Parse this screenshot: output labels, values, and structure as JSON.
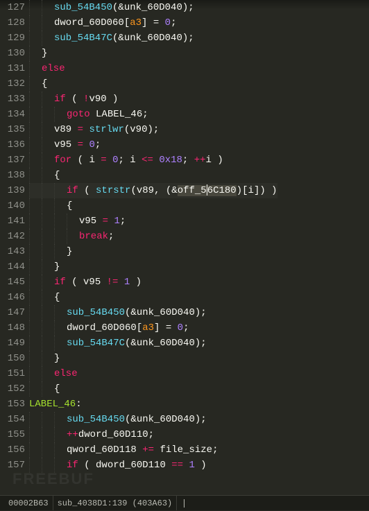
{
  "firstLine": 127,
  "lines": [
    {
      "indent": 2,
      "tokens": [
        {
          "t": "sub_54B450",
          "c": "fn"
        },
        {
          "t": "(&",
          "c": "punct"
        },
        {
          "t": "unk_60D040",
          "c": "id"
        },
        {
          "t": ");",
          "c": "punct"
        }
      ]
    },
    {
      "indent": 2,
      "tokens": [
        {
          "t": "dword_60D060",
          "c": "id"
        },
        {
          "t": "[",
          "c": "punct"
        },
        {
          "t": "a3",
          "c": "param"
        },
        {
          "t": "] = ",
          "c": "punct"
        },
        {
          "t": "0",
          "c": "num"
        },
        {
          "t": ";",
          "c": "punct"
        }
      ]
    },
    {
      "indent": 2,
      "tokens": [
        {
          "t": "sub_54B47C",
          "c": "fn"
        },
        {
          "t": "(&",
          "c": "punct"
        },
        {
          "t": "unk_60D040",
          "c": "id"
        },
        {
          "t": ");",
          "c": "punct"
        }
      ]
    },
    {
      "indent": 1,
      "tokens": [
        {
          "t": "}",
          "c": "punct"
        }
      ]
    },
    {
      "indent": 1,
      "tokens": [
        {
          "t": "else",
          "c": "kw"
        }
      ]
    },
    {
      "indent": 1,
      "tokens": [
        {
          "t": "{",
          "c": "punct"
        }
      ]
    },
    {
      "indent": 2,
      "tokens": [
        {
          "t": "if",
          "c": "kw"
        },
        {
          "t": " ( ",
          "c": "punct"
        },
        {
          "t": "!",
          "c": "op"
        },
        {
          "t": "v90",
          "c": "id"
        },
        {
          "t": " )",
          "c": "punct"
        }
      ]
    },
    {
      "indent": 3,
      "tokens": [
        {
          "t": "goto",
          "c": "kw"
        },
        {
          "t": " ",
          "c": "punct"
        },
        {
          "t": "LABEL_46",
          "c": "id"
        },
        {
          "t": ";",
          "c": "punct"
        }
      ]
    },
    {
      "indent": 2,
      "tokens": [
        {
          "t": "v89",
          "c": "id"
        },
        {
          "t": " ",
          "c": "punct"
        },
        {
          "t": "=",
          "c": "op"
        },
        {
          "t": " ",
          "c": "punct"
        },
        {
          "t": "strlwr",
          "c": "fn"
        },
        {
          "t": "(",
          "c": "punct"
        },
        {
          "t": "v90",
          "c": "id"
        },
        {
          "t": ");",
          "c": "punct"
        }
      ]
    },
    {
      "indent": 2,
      "tokens": [
        {
          "t": "v95",
          "c": "id"
        },
        {
          "t": " ",
          "c": "punct"
        },
        {
          "t": "=",
          "c": "op"
        },
        {
          "t": " ",
          "c": "punct"
        },
        {
          "t": "0",
          "c": "num"
        },
        {
          "t": ";",
          "c": "punct"
        }
      ]
    },
    {
      "indent": 2,
      "tokens": [
        {
          "t": "for",
          "c": "kw"
        },
        {
          "t": " ( ",
          "c": "punct"
        },
        {
          "t": "i",
          "c": "id"
        },
        {
          "t": " ",
          "c": "punct"
        },
        {
          "t": "=",
          "c": "op"
        },
        {
          "t": " ",
          "c": "punct"
        },
        {
          "t": "0",
          "c": "num"
        },
        {
          "t": "; ",
          "c": "punct"
        },
        {
          "t": "i",
          "c": "id"
        },
        {
          "t": " ",
          "c": "punct"
        },
        {
          "t": "<=",
          "c": "op"
        },
        {
          "t": " ",
          "c": "punct"
        },
        {
          "t": "0x18",
          "c": "num"
        },
        {
          "t": "; ",
          "c": "punct"
        },
        {
          "t": "++",
          "c": "op"
        },
        {
          "t": "i",
          "c": "id"
        },
        {
          "t": " )",
          "c": "punct"
        }
      ]
    },
    {
      "indent": 2,
      "tokens": [
        {
          "t": "{",
          "c": "punct"
        }
      ]
    },
    {
      "indent": 3,
      "tokens": [
        {
          "t": "if",
          "c": "kw"
        },
        {
          "t": " ( ",
          "c": "punct"
        },
        {
          "t": "strstr",
          "c": "fn"
        },
        {
          "t": "(",
          "c": "punct"
        },
        {
          "t": "v89",
          "c": "id"
        },
        {
          "t": ", (&",
          "c": "punct"
        },
        {
          "t": "off_5",
          "c": "id",
          "sel": true
        },
        {
          "t": "6C180",
          "c": "id",
          "sel": true,
          "caretBefore": true
        },
        {
          "t": ")[",
          "c": "punct"
        },
        {
          "t": "i",
          "c": "id"
        },
        {
          "t": "]) )",
          "c": "punct"
        }
      ],
      "highlight": true
    },
    {
      "indent": 3,
      "tokens": [
        {
          "t": "{",
          "c": "punct"
        }
      ]
    },
    {
      "indent": 4,
      "tokens": [
        {
          "t": "v95",
          "c": "id"
        },
        {
          "t": " ",
          "c": "punct"
        },
        {
          "t": "=",
          "c": "op"
        },
        {
          "t": " ",
          "c": "punct"
        },
        {
          "t": "1",
          "c": "num"
        },
        {
          "t": ";",
          "c": "punct"
        }
      ]
    },
    {
      "indent": 4,
      "tokens": [
        {
          "t": "break",
          "c": "kw"
        },
        {
          "t": ";",
          "c": "punct"
        }
      ]
    },
    {
      "indent": 3,
      "tokens": [
        {
          "t": "}",
          "c": "punct"
        }
      ]
    },
    {
      "indent": 2,
      "tokens": [
        {
          "t": "}",
          "c": "punct"
        }
      ]
    },
    {
      "indent": 2,
      "tokens": [
        {
          "t": "if",
          "c": "kw"
        },
        {
          "t": " ( ",
          "c": "punct"
        },
        {
          "t": "v95",
          "c": "id"
        },
        {
          "t": " ",
          "c": "punct"
        },
        {
          "t": "!=",
          "c": "op"
        },
        {
          "t": " ",
          "c": "punct"
        },
        {
          "t": "1",
          "c": "num"
        },
        {
          "t": " )",
          "c": "punct"
        }
      ]
    },
    {
      "indent": 2,
      "tokens": [
        {
          "t": "{",
          "c": "punct"
        }
      ]
    },
    {
      "indent": 3,
      "tokens": [
        {
          "t": "sub_54B450",
          "c": "fn"
        },
        {
          "t": "(&",
          "c": "punct"
        },
        {
          "t": "unk_60D040",
          "c": "id"
        },
        {
          "t": ");",
          "c": "punct"
        }
      ]
    },
    {
      "indent": 3,
      "tokens": [
        {
          "t": "dword_60D060",
          "c": "id"
        },
        {
          "t": "[",
          "c": "punct"
        },
        {
          "t": "a3",
          "c": "param"
        },
        {
          "t": "] = ",
          "c": "punct"
        },
        {
          "t": "0",
          "c": "num"
        },
        {
          "t": ";",
          "c": "punct"
        }
      ]
    },
    {
      "indent": 3,
      "tokens": [
        {
          "t": "sub_54B47C",
          "c": "fn"
        },
        {
          "t": "(&",
          "c": "punct"
        },
        {
          "t": "unk_60D040",
          "c": "id"
        },
        {
          "t": ");",
          "c": "punct"
        }
      ]
    },
    {
      "indent": 2,
      "tokens": [
        {
          "t": "}",
          "c": "punct"
        }
      ]
    },
    {
      "indent": 2,
      "tokens": [
        {
          "t": "else",
          "c": "kw"
        }
      ]
    },
    {
      "indent": 2,
      "tokens": [
        {
          "t": "{",
          "c": "punct"
        }
      ]
    },
    {
      "indent": 0,
      "tokens": [
        {
          "t": "LABEL_46",
          "c": "label"
        },
        {
          "t": ":",
          "c": "punct"
        }
      ]
    },
    {
      "indent": 3,
      "tokens": [
        {
          "t": "sub_54B450",
          "c": "fn"
        },
        {
          "t": "(&",
          "c": "punct"
        },
        {
          "t": "unk_60D040",
          "c": "id"
        },
        {
          "t": ");",
          "c": "punct"
        }
      ]
    },
    {
      "indent": 3,
      "tokens": [
        {
          "t": "++",
          "c": "op"
        },
        {
          "t": "dword_60D110",
          "c": "id"
        },
        {
          "t": ";",
          "c": "punct"
        }
      ]
    },
    {
      "indent": 3,
      "tokens": [
        {
          "t": "qword_60D118",
          "c": "id"
        },
        {
          "t": " ",
          "c": "punct"
        },
        {
          "t": "+=",
          "c": "op"
        },
        {
          "t": " ",
          "c": "punct"
        },
        {
          "t": "file_size",
          "c": "id"
        },
        {
          "t": ";",
          "c": "punct"
        }
      ]
    },
    {
      "indent": 3,
      "tokens": [
        {
          "t": "if",
          "c": "kw"
        },
        {
          "t": " ( ",
          "c": "punct"
        },
        {
          "t": "dword_60D110",
          "c": "id"
        },
        {
          "t": " ",
          "c": "punct"
        },
        {
          "t": "==",
          "c": "op"
        },
        {
          "t": " ",
          "c": "punct"
        },
        {
          "t": "1",
          "c": "num"
        },
        {
          "t": " )",
          "c": "punct"
        }
      ]
    }
  ],
  "status": {
    "offset": "00002B63",
    "loc": "sub_4038D1:139 (403A63)"
  },
  "watermark": "FREEBUF"
}
